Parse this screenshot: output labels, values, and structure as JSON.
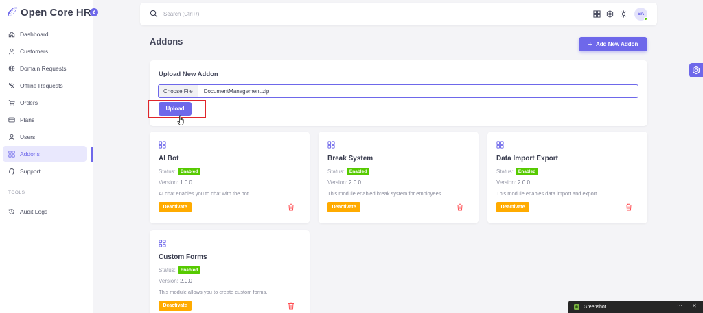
{
  "app": {
    "brand_name": "Open Core HR",
    "collapse_icon": "chevron-left-icon"
  },
  "sidebar": {
    "items": [
      {
        "label": "Dashboard",
        "icon": "home-icon"
      },
      {
        "label": "Customers",
        "icon": "user-icon"
      },
      {
        "label": "Domain Requests",
        "icon": "globe-icon"
      },
      {
        "label": "Offline Requests",
        "icon": "wifi-off-icon"
      },
      {
        "label": "Orders",
        "icon": "cart-icon"
      },
      {
        "label": "Plans",
        "icon": "credit-card-icon"
      },
      {
        "label": "Users",
        "icon": "user-icon"
      },
      {
        "label": "Addons",
        "icon": "grid-icon",
        "active": true
      },
      {
        "label": "Support",
        "icon": "headset-icon"
      }
    ],
    "section_label": "TOOLS",
    "tools_items": [
      {
        "label": "Audit Logs",
        "icon": "history-icon"
      }
    ]
  },
  "topbar": {
    "search_placeholder": "Search (Ctrl+/)",
    "avatar_initials": "SA"
  },
  "page": {
    "title": "Addons",
    "add_button_label": "Add New Addon"
  },
  "upload": {
    "title": "Upload New Addon",
    "choose_file_label": "Choose File",
    "file_name": "DocumentManagement.zip",
    "upload_button_label": "Upload"
  },
  "addons": [
    {
      "name": "AI Bot",
      "status_label": "Status:",
      "status": "Enabled",
      "version_label": "Version:",
      "version": "1.0.0",
      "description": "AI chat enables you to chat with the bot",
      "button_label": "Deactivate"
    },
    {
      "name": "Break System",
      "status_label": "Status:",
      "status": "Enabled",
      "version_label": "Version:",
      "version": "2.0.0",
      "description": "This module enabled break system for employees.",
      "button_label": "Deactivate"
    },
    {
      "name": "Data Import Export",
      "status_label": "Status:",
      "status": "Enabled",
      "version_label": "Version:",
      "version": "2.0.0",
      "description": "This module enables data import and export.",
      "button_label": "Deactivate"
    },
    {
      "name": "Custom Forms",
      "status_label": "Status:",
      "status": "Enabled",
      "version_label": "Version:",
      "version": "2.0.0",
      "description": "This module allows you to create custom forms.",
      "button_label": "Deactivate"
    }
  ],
  "taskbar": {
    "title": "Greenshot",
    "more_label": "···",
    "close_label": "✕"
  },
  "colors": {
    "primary": "#6e68ea",
    "success": "#56ca00",
    "warning": "#ffab00",
    "danger": "#ff4c51",
    "highlight": "#e0262b"
  }
}
